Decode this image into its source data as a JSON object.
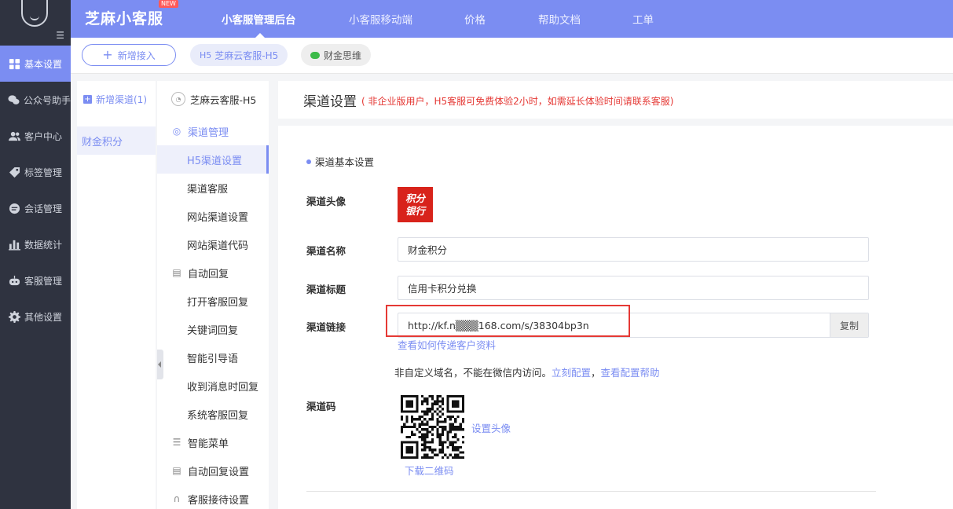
{
  "sidebar": {
    "items": [
      {
        "label": "基本设置",
        "icon": "grid-icon",
        "active": true
      },
      {
        "label": "公众号助手",
        "icon": "wechat-icon",
        "active": false
      },
      {
        "label": "客户中心",
        "icon": "users-icon",
        "active": false
      },
      {
        "label": "标签管理",
        "icon": "tag-icon",
        "active": false
      },
      {
        "label": "会话管理",
        "icon": "chat-icon",
        "active": false
      },
      {
        "label": "数据统计",
        "icon": "bar-chart-icon",
        "active": false
      },
      {
        "label": "客服管理",
        "icon": "robot-icon",
        "active": false
      },
      {
        "label": "其他设置",
        "icon": "gear-icon",
        "active": false
      }
    ]
  },
  "topbar": {
    "brand": "芝麻小客服",
    "brand_badge": "NEW",
    "nav": [
      "小客服管理后台",
      "小客服移动端",
      "价格",
      "帮助文档",
      "工单"
    ]
  },
  "tabs": {
    "add_label": "新增接入",
    "h5_tag": "H5",
    "h5_label": "芝麻云客服-H5",
    "wechat_label": "财金思维"
  },
  "channels": {
    "add_label": "新增渠道(1)",
    "items": [
      "财金积分"
    ]
  },
  "menu": {
    "header": "芝麻云客服-H5",
    "groups": [
      {
        "label": "渠道管理",
        "subs": [
          "H5渠道设置",
          "渠道客服",
          "网站渠道设置",
          "网站渠道代码"
        ]
      },
      {
        "label": "自动回复",
        "subs": [
          "打开客服回复",
          "关键词回复",
          "智能引导语",
          "收到消息时回复",
          "系统客服回复"
        ]
      },
      {
        "label": "智能菜单",
        "subs": []
      },
      {
        "label": "自动回复设置",
        "subs": []
      },
      {
        "label": "客服接待设置",
        "subs": []
      }
    ]
  },
  "main": {
    "title": "渠道设置",
    "note": "( 非企业版用户，H5客服可免费体验2小时，如需延长体验时间请联系客服)",
    "section": "渠道基本设置",
    "avatar_label": "渠道头像",
    "avatar_text": [
      "积分",
      "银行"
    ],
    "name_label": "渠道名称",
    "name_value": "财金积分",
    "title_label": "渠道标题",
    "title_value": "信用卡积分兑换",
    "link_label": "渠道链接",
    "link_value": "http://kf.n▒▒▒168.com/s/38304bp3n",
    "copy_label": "复制",
    "pass_info_link": "查看如何传递客户资料",
    "notice_text": "非自定义域名，不能在微信内访问。",
    "config_now": "立刻配置",
    "config_sep": "，",
    "config_help": "查看配置帮助",
    "qr_label": "渠道码",
    "set_avatar": "设置头像",
    "download_qr": "下载二维码"
  },
  "colors": {
    "accent": "#7b8df2",
    "sidebar": "#2f3340",
    "warning": "#e53935"
  }
}
